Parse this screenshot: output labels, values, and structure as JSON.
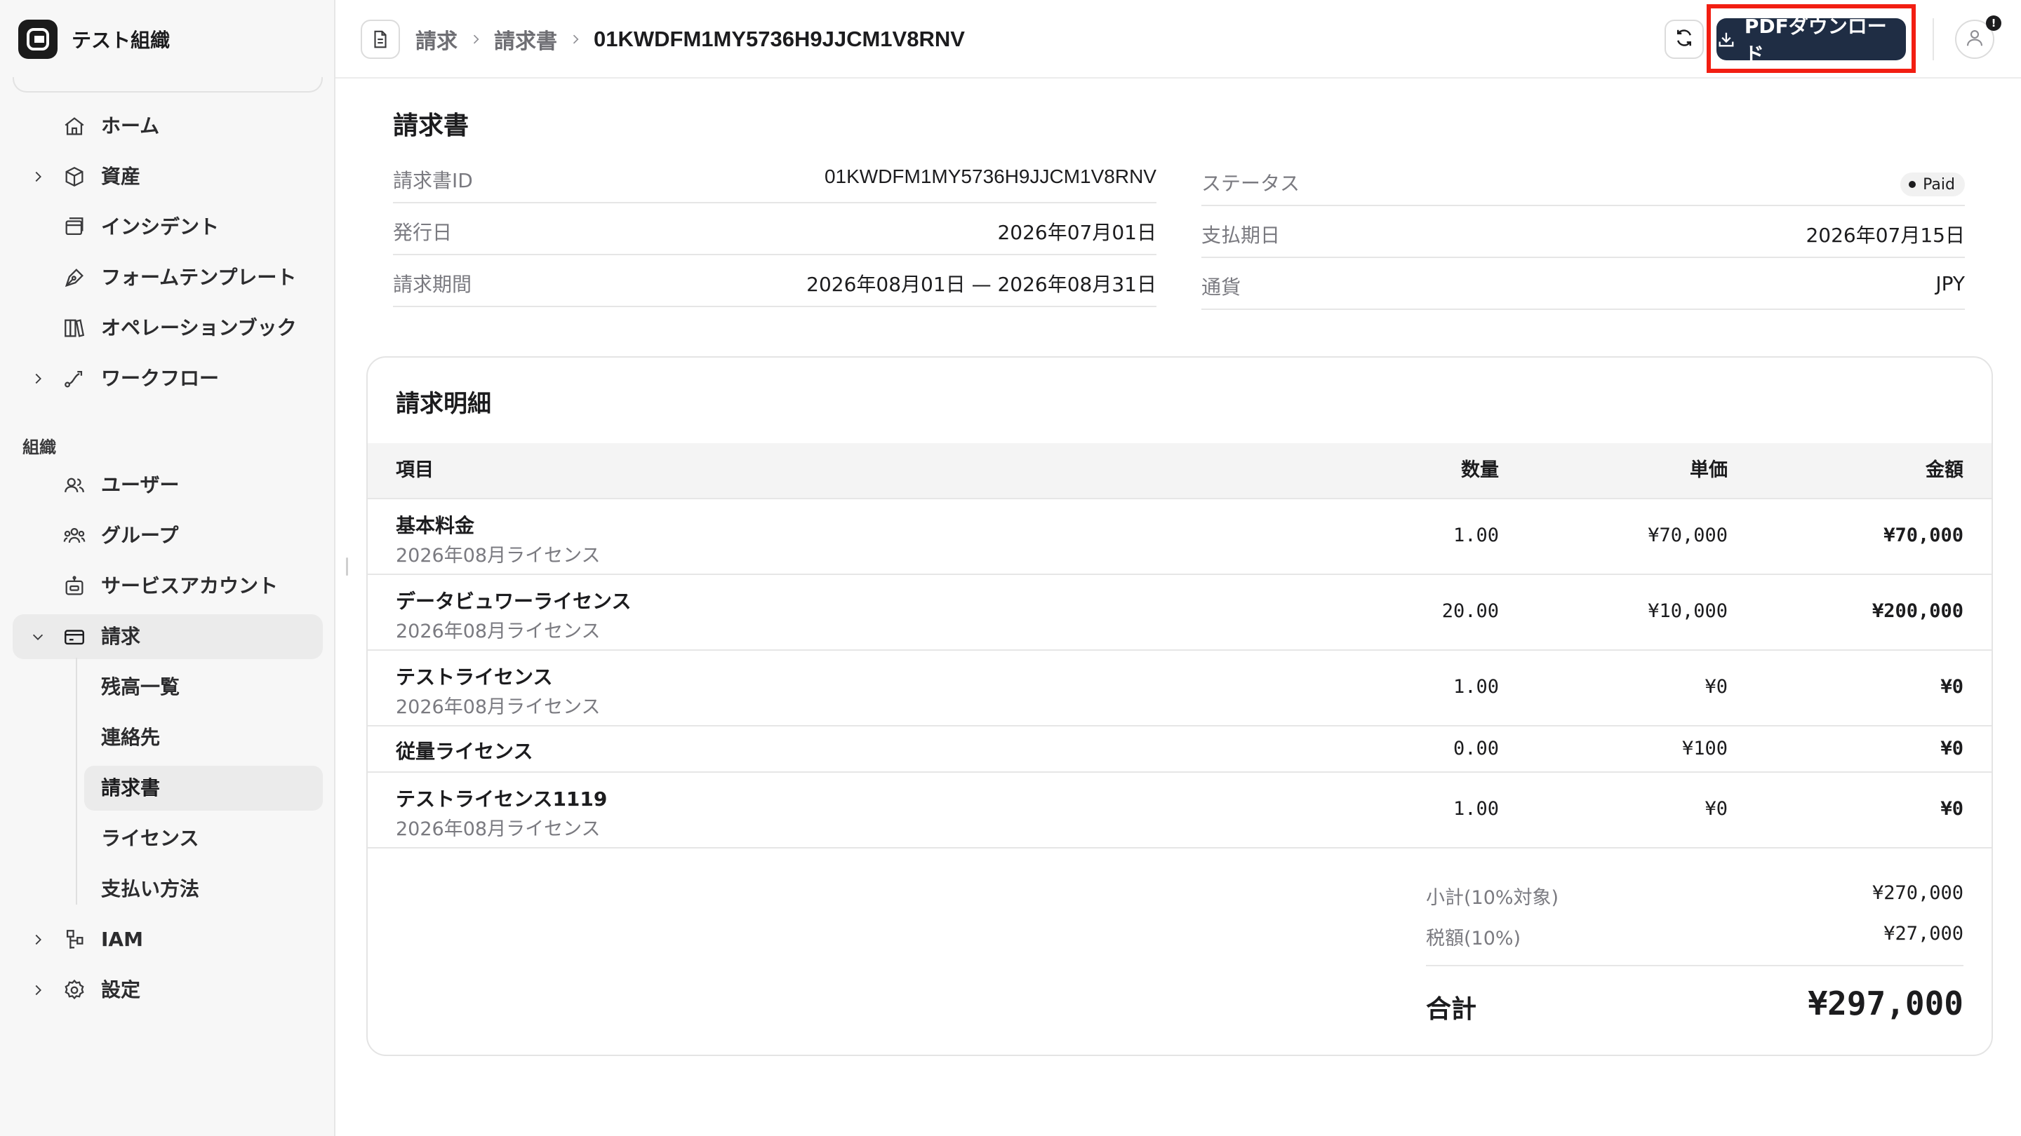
{
  "org": {
    "name": "テスト組織"
  },
  "sidebar": {
    "items": [
      {
        "label": "ホーム",
        "icon": "home-icon"
      },
      {
        "label": "資産",
        "icon": "cube-icon"
      },
      {
        "label": "インシデント",
        "icon": "window-icon"
      },
      {
        "label": "フォームテンプレート",
        "icon": "pen-icon"
      },
      {
        "label": "オペレーションブック",
        "icon": "books-icon"
      },
      {
        "label": "ワークフロー",
        "icon": "workflow-icon"
      }
    ],
    "section_label": "組織",
    "org_items": [
      {
        "label": "ユーザー",
        "icon": "users-icon"
      },
      {
        "label": "グループ",
        "icon": "group-icon"
      },
      {
        "label": "サービスアカウント",
        "icon": "bot-icon"
      },
      {
        "label": "請求",
        "icon": "billing-icon"
      }
    ],
    "billing_sub": [
      "残高一覧",
      "連絡先",
      "請求書",
      "ライセンス",
      "支払い方法"
    ],
    "bottom_items": [
      {
        "label": "IAM",
        "icon": "iam-icon"
      },
      {
        "label": "設定",
        "icon": "gear-icon"
      }
    ]
  },
  "header": {
    "breadcrumb": [
      "請求",
      "請求書",
      "01KWDFM1MY5736H9JJCM1V8RNV"
    ],
    "pdf_button": "PDFダウンロード",
    "notification_badge": "!"
  },
  "invoice": {
    "title": "請求書",
    "left": [
      {
        "label": "請求書ID",
        "value": "01KWDFM1MY5736H9JJCM1V8RNV"
      },
      {
        "label": "発行日",
        "value": "2026年07月01日"
      },
      {
        "label": "請求期間",
        "value": "2026年08月01日 — 2026年08月31日"
      }
    ],
    "right": [
      {
        "label": "ステータス",
        "value": "Paid"
      },
      {
        "label": "支払期日",
        "value": "2026年07月15日"
      },
      {
        "label": "通貨",
        "value": "JPY"
      }
    ]
  },
  "details": {
    "title": "請求明細",
    "columns": [
      "項目",
      "数量",
      "単価",
      "金額"
    ],
    "rows": [
      {
        "name": "基本料金",
        "desc": "2026年08月ライセンス",
        "qty": "1.00",
        "unit": "¥70,000",
        "amount": "¥70,000"
      },
      {
        "name": "データビュワーライセンス",
        "desc": "2026年08月ライセンス",
        "qty": "20.00",
        "unit": "¥10,000",
        "amount": "¥200,000"
      },
      {
        "name": "テストライセンス",
        "desc": "2026年08月ライセンス",
        "qty": "1.00",
        "unit": "¥0",
        "amount": "¥0"
      },
      {
        "name": "従量ライセンス",
        "desc": "",
        "qty": "0.00",
        "unit": "¥100",
        "amount": "¥0"
      },
      {
        "name": "テストライセンス1119",
        "desc": "2026年08月ライセンス",
        "qty": "1.00",
        "unit": "¥0",
        "amount": "¥0"
      }
    ],
    "subtotal_label": "小計(10%対象)",
    "subtotal": "¥270,000",
    "tax_label": "税額(10%)",
    "tax": "¥27,000",
    "total_label": "合計",
    "total": "¥297,000"
  },
  "colors": {
    "primary_button": "#1f2d44",
    "highlight": "#f21e12"
  }
}
